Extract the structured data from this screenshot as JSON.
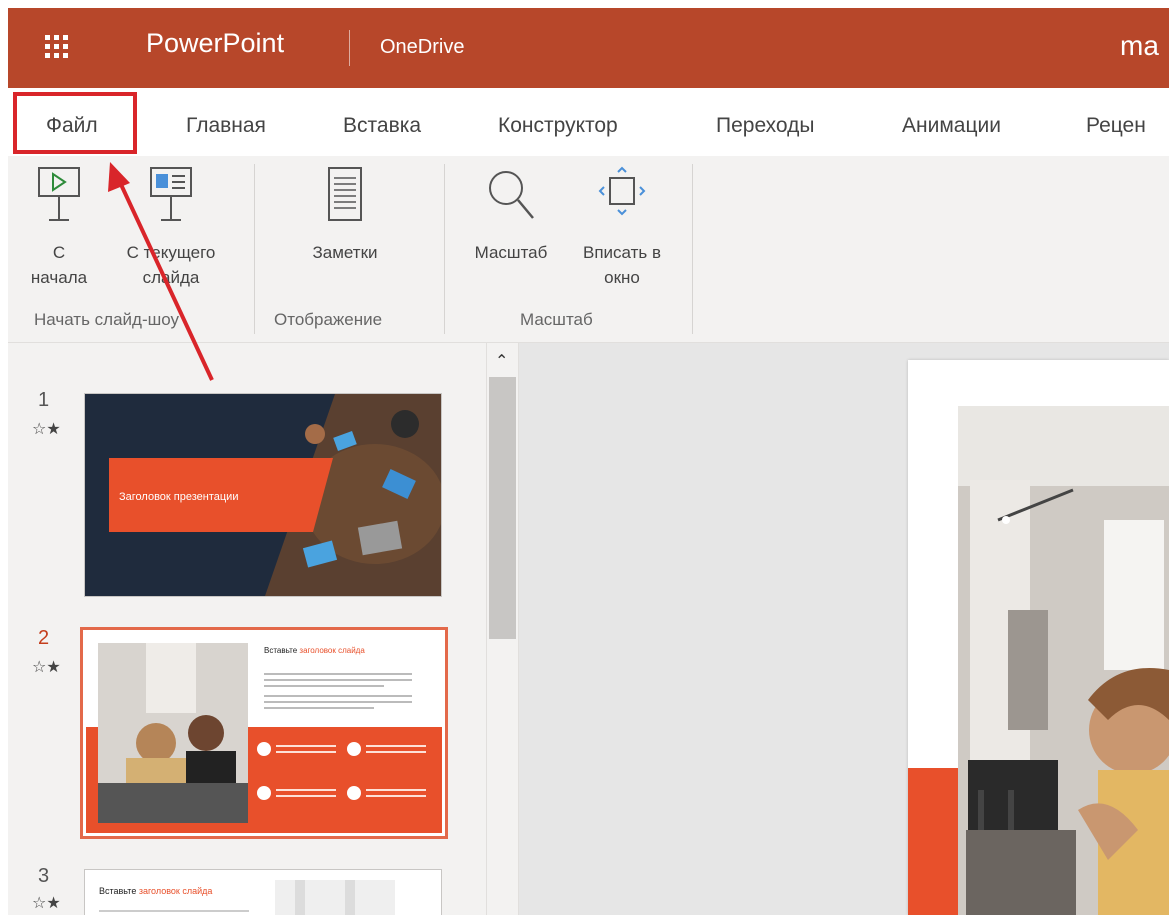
{
  "header": {
    "app_name": "PowerPoint",
    "location": "OneDrive",
    "user_partial": "ma",
    "brand_color": "#b7472a"
  },
  "tabs": [
    {
      "label": "Файл",
      "highlighted": true
    },
    {
      "label": "Главная"
    },
    {
      "label": "Вставка"
    },
    {
      "label": "Конструктор"
    },
    {
      "label": "Переходы"
    },
    {
      "label": "Анимации"
    },
    {
      "label": "Рецен"
    }
  ],
  "ribbon": {
    "groups": [
      {
        "label": "Начать слайд-шоу",
        "buttons": [
          {
            "line1": "С",
            "line2": "начала",
            "icon": "play-from-start-icon"
          },
          {
            "line1": "С текущего",
            "line2": "слайда",
            "icon": "play-from-current-icon"
          }
        ]
      },
      {
        "label": "Отображение",
        "buttons": [
          {
            "line1": "Заметки",
            "icon": "notes-icon"
          }
        ]
      },
      {
        "label": "Масштаб",
        "buttons": [
          {
            "line1": "Масштаб",
            "icon": "zoom-icon"
          },
          {
            "line1": "Вписать в",
            "line2": "окно",
            "icon": "fit-to-window-icon"
          }
        ]
      }
    ]
  },
  "slides": [
    {
      "number": "1",
      "star": "☆★",
      "title": "Заголовок презентации"
    },
    {
      "number": "2",
      "star": "☆★",
      "title_prefix": "Вставьте",
      "title_accent": "заголовок слайда",
      "selected": true
    },
    {
      "number": "3",
      "star": "☆★",
      "title_prefix": "Вставьте",
      "title_accent": "заголовок слайда"
    }
  ],
  "colors": {
    "accent": "#e8502b",
    "dark_navy": "#1f2b3d",
    "annotation_red": "#d9252a"
  }
}
